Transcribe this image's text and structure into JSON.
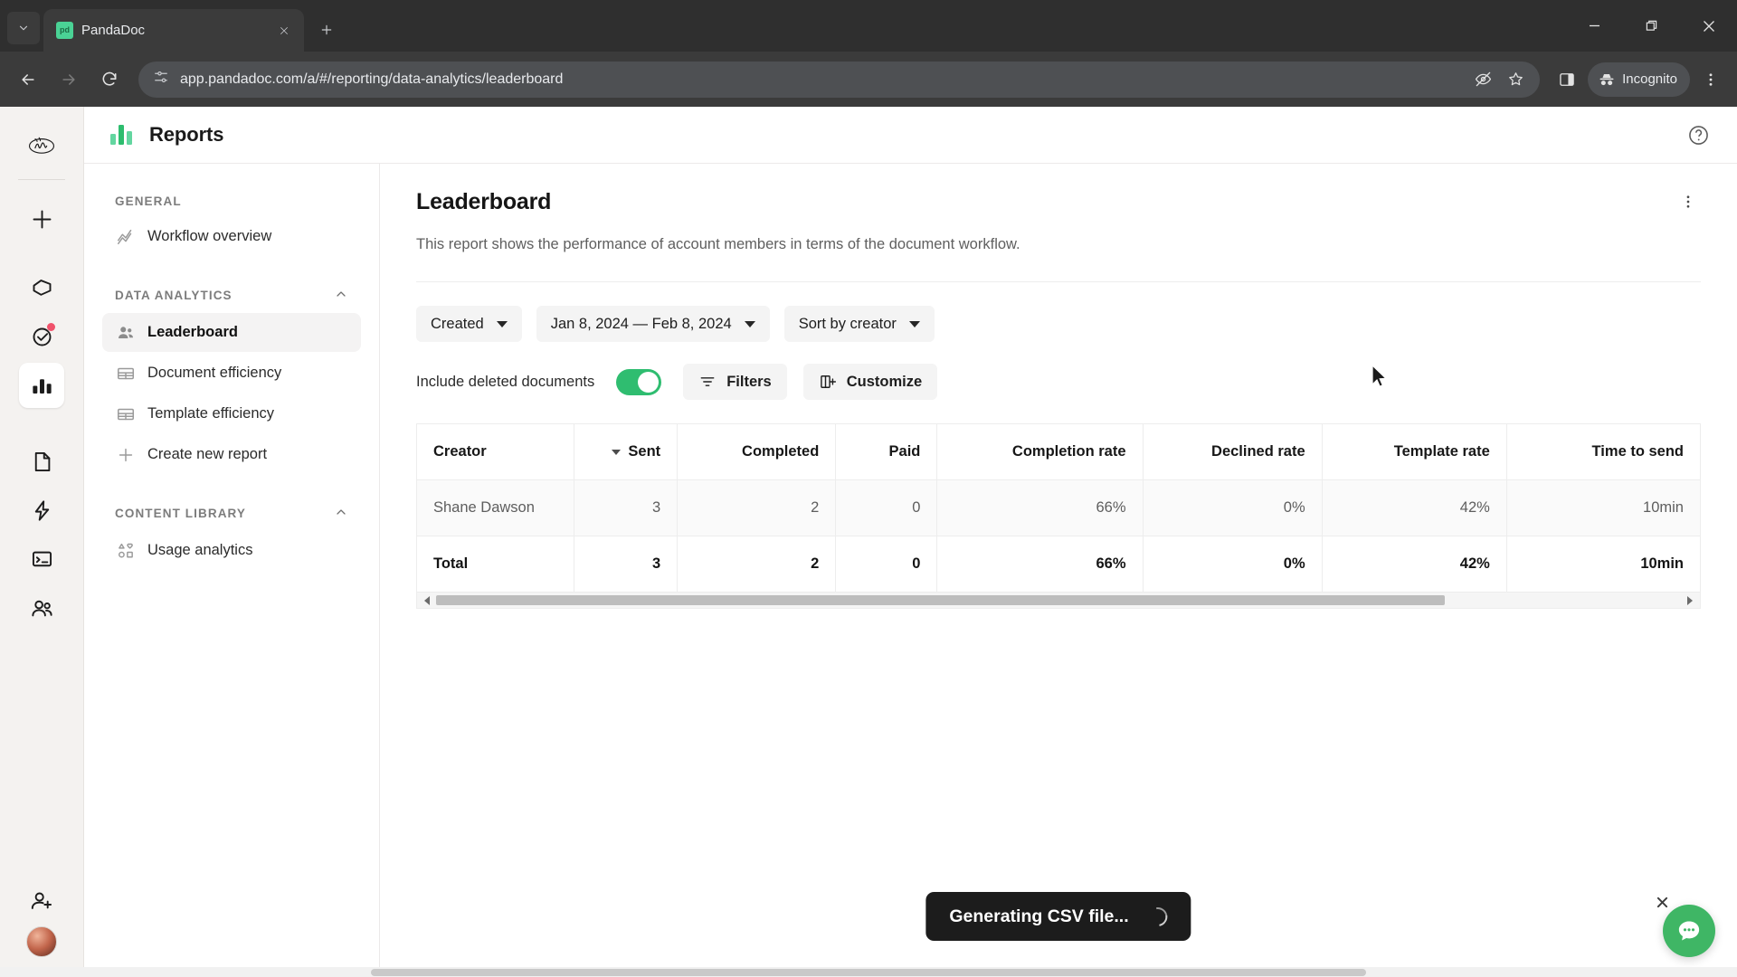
{
  "browser": {
    "tab": {
      "title": "PandaDoc",
      "favicon_label": "pd",
      "favicon_name": "pandadoc-favicon"
    },
    "url": "app.pandadoc.com/a/#/reporting/data-analytics/leaderboard",
    "profile_label": "Incognito",
    "window_controls": {
      "minimize": "minimize",
      "maximize": "maximize",
      "close": "close"
    }
  },
  "rail": {
    "logo_name": "workspace-logo",
    "items": [
      {
        "name": "create-new",
        "icon": "plus-icon",
        "badge": false,
        "active": false
      },
      {
        "name": "home",
        "icon": "home-pentagon-icon",
        "badge": false,
        "active": false
      },
      {
        "name": "tasks",
        "icon": "check-circle-icon",
        "badge": true,
        "active": false
      },
      {
        "name": "reports",
        "icon": "bar-chart-icon",
        "badge": false,
        "active": true
      },
      {
        "name": "documents",
        "icon": "document-icon",
        "badge": false,
        "active": false
      },
      {
        "name": "automations",
        "icon": "lightning-bolt-icon",
        "badge": false,
        "active": false
      },
      {
        "name": "forms",
        "icon": "terminal-icon",
        "badge": false,
        "active": false
      },
      {
        "name": "contacts",
        "icon": "people-icon",
        "badge": false,
        "active": false
      },
      {
        "name": "invite-members",
        "icon": "person-add-icon",
        "badge": false,
        "active": false
      }
    ]
  },
  "reports_header": {
    "title": "Reports",
    "logo_name": "reports-logo",
    "help_icon": "help-circle-icon"
  },
  "subnav": {
    "groups": [
      {
        "name": "general",
        "label": "GENERAL",
        "collapsible": false,
        "items": [
          {
            "label": "Workflow overview",
            "icon": "trend-line-icon",
            "active": false
          }
        ]
      },
      {
        "name": "data-analytics",
        "label": "DATA ANALYTICS",
        "collapsible": true,
        "items": [
          {
            "label": "Leaderboard",
            "icon": "people-icon",
            "active": true
          },
          {
            "label": "Document efficiency",
            "icon": "table-icon",
            "active": false
          },
          {
            "label": "Template efficiency",
            "icon": "table-icon",
            "active": false
          },
          {
            "label": "Create new report",
            "icon": "plus-icon",
            "active": false
          }
        ]
      },
      {
        "name": "content-library",
        "label": "CONTENT LIBRARY",
        "collapsible": true,
        "items": [
          {
            "label": "Usage analytics",
            "icon": "shapes-grid-icon",
            "active": false
          }
        ]
      }
    ]
  },
  "main": {
    "title": "Leaderboard",
    "description": "This report shows the performance of account members in terms of the document workflow.",
    "kebab_icon": "more-vertical-icon",
    "filters": {
      "date_field": "Created",
      "date_range": "Jan 8, 2024 — Feb 8, 2024",
      "sort": "Sort by creator",
      "include_deleted_label": "Include deleted documents",
      "include_deleted_on": true,
      "filters_button": "Filters",
      "customize_button": "Customize"
    }
  },
  "chart_data": {
    "type": "table",
    "title": "Leaderboard",
    "columns": [
      "Creator",
      "Sent",
      "Completed",
      "Paid",
      "Completion rate",
      "Declined rate",
      "Template rate",
      "Time to send"
    ],
    "sorted_column": "Sent",
    "sort_direction": "desc",
    "rows": [
      {
        "type": "data",
        "Creator": "Shane Dawson",
        "Sent": "3",
        "Completed": "2",
        "Paid": "0",
        "Completion rate": "66%",
        "Declined rate": "0%",
        "Template rate": "42%",
        "Time to send": "10min"
      },
      {
        "type": "total",
        "Creator": "Total",
        "Sent": "3",
        "Completed": "2",
        "Paid": "0",
        "Completion rate": "66%",
        "Declined rate": "0%",
        "Template rate": "42%",
        "Time to send": "10min"
      }
    ]
  },
  "toast": {
    "text": "Generating CSV file...",
    "spinner": true
  },
  "chat": {
    "icon": "chat-bubble-icon",
    "close_icon": "close-icon",
    "color": "#3fb665"
  },
  "colors": {
    "accent_green": "#3fb665",
    "toggle_on": "#2fbd70",
    "badge_red": "#f0526b"
  }
}
